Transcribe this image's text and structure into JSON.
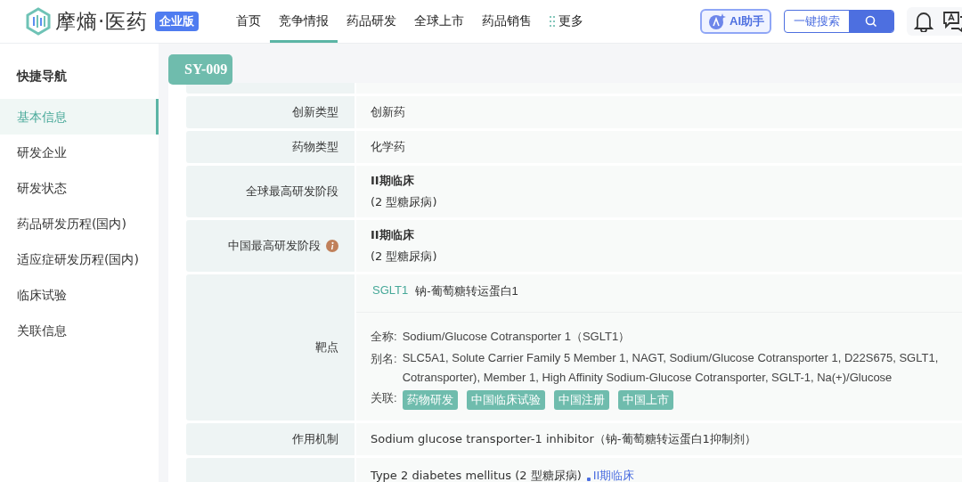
{
  "header": {
    "logo_text": "摩熵·医药",
    "edition_badge": "企业版",
    "nav": [
      {
        "label": "首页",
        "selected": false
      },
      {
        "label": "竞争情报",
        "selected": true
      },
      {
        "label": "药品研发",
        "selected": false
      },
      {
        "label": "全球上市",
        "selected": false
      },
      {
        "label": "药品销售",
        "selected": false
      },
      {
        "label": "更多",
        "selected": false
      }
    ],
    "ai_button": "AI助手",
    "search_button": "一键搜索"
  },
  "sidebar": {
    "title": "快捷导航",
    "items": [
      {
        "label": "基本信息",
        "selected": true
      },
      {
        "label": "研发企业",
        "selected": false
      },
      {
        "label": "研发状态",
        "selected": false
      },
      {
        "label": "药品研发历程(国内)",
        "selected": false
      },
      {
        "label": "适应症研发历程(国内)",
        "selected": false
      },
      {
        "label": "临床试验",
        "selected": false
      },
      {
        "label": "关联信息",
        "selected": false
      }
    ]
  },
  "drug_badge": "SY-009",
  "rows": [
    {
      "kind": "blank"
    },
    {
      "kind": "plain",
      "label": "创新类型",
      "value": "创新药"
    },
    {
      "kind": "plain",
      "label": "药物类型",
      "value": "化学药"
    },
    {
      "kind": "stage",
      "label": "全球最高研发阶段",
      "stage": "II期临床",
      "note": "(2 型糖尿病)",
      "info": false
    },
    {
      "kind": "stage",
      "label": "中国最高研发阶段",
      "stage": "II期临床",
      "note": "(2 型糖尿病)",
      "info": true
    },
    {
      "kind": "target",
      "label": "靶点",
      "symbol": "SGLT1",
      "name": "钠-葡萄糖转运蛋白1",
      "full_name_label": "全称:",
      "full_name": "Sodium/Glucose Cotransporter 1（SGLT1）",
      "alias_label": "别名:",
      "alias_lines": [
        "SLC5A1, Solute Carrier Family 5 Member 1, NAGT, Sodium/Glucose Cotransporter 1, D22S675, SGLT1,",
        "Cotransporter), Member 1, High Affinity Sodium-Glucose Cotransporter, SGLT-1, Na(+)/Glucose"
      ],
      "links_label": "关联:",
      "links": [
        "药物研发",
        "中国临床试验",
        "中国注册",
        "中国上市"
      ]
    },
    {
      "kind": "plain",
      "label": "作用机制",
      "value": "Sodium glucose transporter-1 inhibitor（钠-葡萄糖转运蛋白1抑制剂）"
    },
    {
      "kind": "indication",
      "value": "Type 2 diabetes mellitus (2 型糖尿病)",
      "stage_link": "II期临床"
    }
  ]
}
